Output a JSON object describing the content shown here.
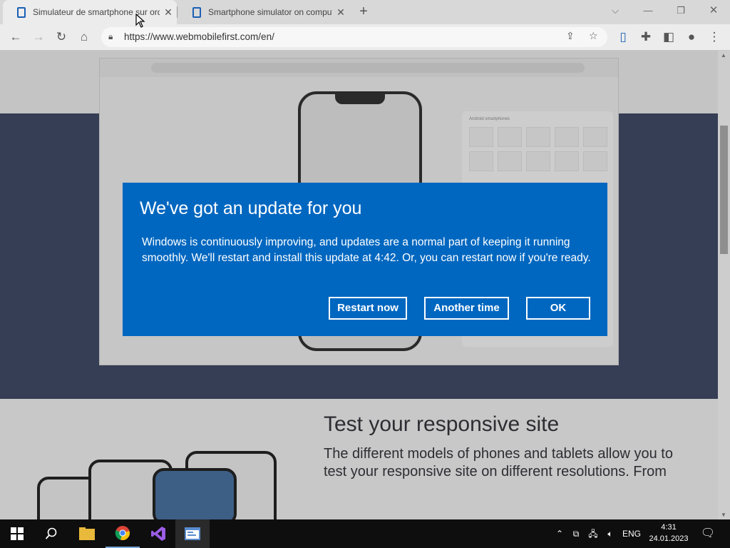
{
  "browser": {
    "tabs": [
      {
        "title": "Simulateur de smartphone sur ordinateur",
        "active": true
      },
      {
        "title": "Smartphone simulator on computer",
        "active": false
      }
    ],
    "url": "https://www.webmobilefirst.com/en/"
  },
  "dialog": {
    "title": "We've got an update for you",
    "body": "Windows is continuously improving, and updates are a normal part of keeping it running smoothly. We'll restart and install this update at 4:42. Or, you can restart now if you're ready.",
    "buttons": {
      "restart": "Restart now",
      "another": "Another time",
      "ok": "OK"
    },
    "accent_color": "#0067c0"
  },
  "page": {
    "mock_card_title": "Android smartphones",
    "heading": "Test your responsive site",
    "text": "The different models of phones and tablets allow you to test your responsive site on different resolutions. From"
  },
  "taskbar": {
    "language": "ENG",
    "time": "4:31",
    "date": "24.01.2023"
  }
}
